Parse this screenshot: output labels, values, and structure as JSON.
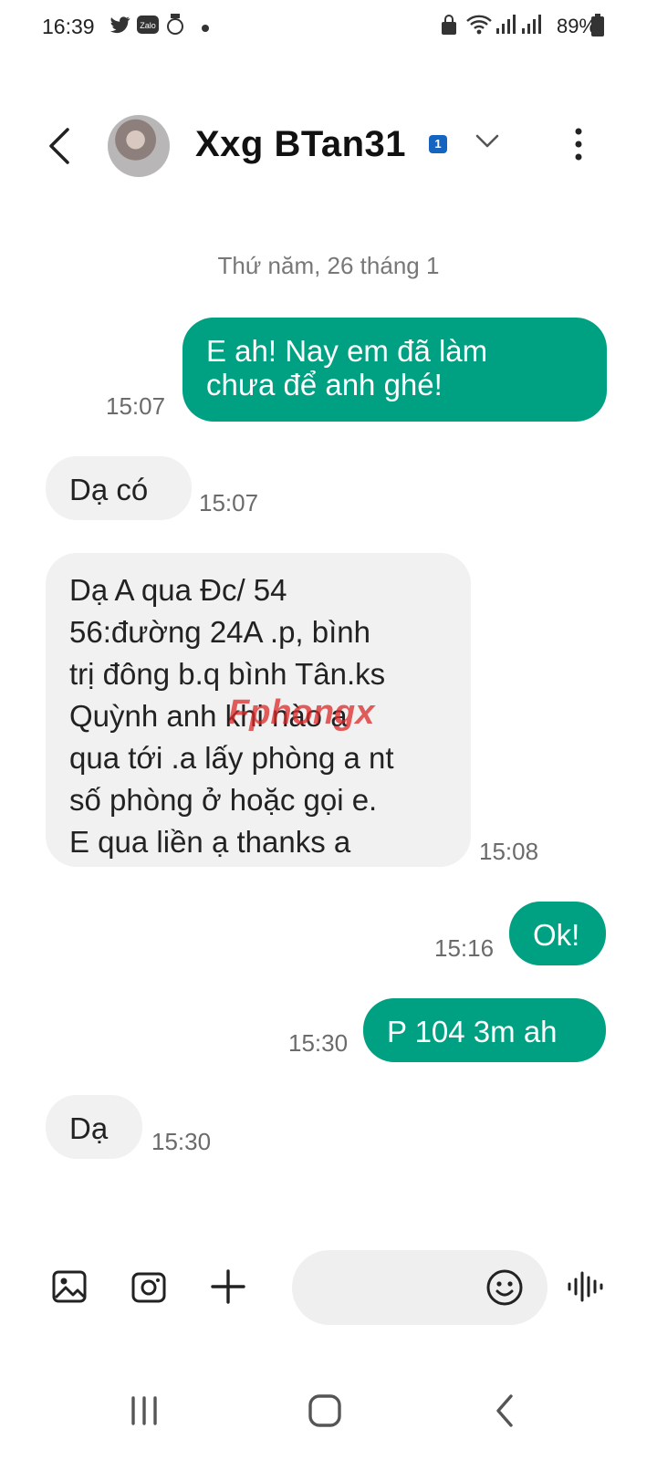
{
  "status_bar": {
    "time": "16:39",
    "battery": "89%",
    "icons": [
      "twitter-icon",
      "zalo-icon",
      "app-icon",
      "dot-icon",
      "lock-icon",
      "wifi-icon",
      "signal-icon",
      "signal-icon",
      "battery-icon"
    ]
  },
  "header": {
    "contact_name": "Xxg BTan31",
    "badge": "1"
  },
  "conversation": {
    "date": "Thứ năm, 26 tháng 1",
    "messages": [
      {
        "direction": "out",
        "text": "E ah! Nay em đã làm\nchưa để anh ghé!",
        "time": "15:07"
      },
      {
        "direction": "in",
        "text": "Dạ có",
        "time": "15:07"
      },
      {
        "direction": "in",
        "text": "Dạ A qua Đc/ 54\n56:đường 24A .p, bình\ntrị đông b.q bình Tân.ks\nQuỳnh anh khi nào a\nqua tới .a lấy phòng a nt\nsố phòng ở hoặc gọi e.\nE qua liền ạ thanks a",
        "time": "15:08"
      },
      {
        "direction": "out",
        "text": "Ok!",
        "time": "15:16"
      },
      {
        "direction": "out",
        "text": "P 104 3m ah",
        "time": "15:30"
      },
      {
        "direction": "in",
        "text": "Dạ",
        "time": "15:30"
      }
    ]
  },
  "watermark": "Fphongx",
  "input_bar": {
    "placeholder": "",
    "icons": [
      "gallery-icon",
      "camera-icon",
      "plus-icon",
      "emoji-icon",
      "voice-icon"
    ]
  },
  "navbar": {
    "icons": [
      "recent-apps-icon",
      "home-icon",
      "back-icon"
    ]
  },
  "colors": {
    "outgoing_bubble": "#00a082",
    "incoming_bubble": "#f1f1f1",
    "badge": "#1565c0"
  }
}
